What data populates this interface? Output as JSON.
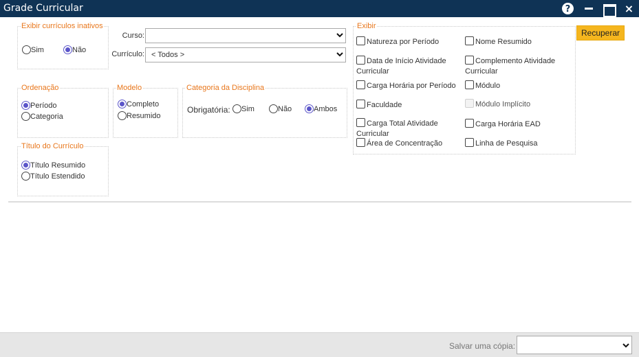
{
  "window": {
    "title": "Grade Curricular",
    "help_label": "?",
    "close_label": "×"
  },
  "inactive_group": {
    "legend": "Exibir currículos inativos",
    "options": [
      "Sim",
      "Não"
    ],
    "selected": "Não"
  },
  "filters": {
    "curso_label": "Curso:",
    "curso_value": "",
    "curriculo_label": "Currículo:",
    "curriculo_value": "< Todos >"
  },
  "ordenacao": {
    "legend": "Ordenação",
    "options": [
      "Período",
      "Categoria"
    ],
    "selected": "Período"
  },
  "modelo": {
    "legend": "Modelo",
    "options": [
      "Completo",
      "Resumido"
    ],
    "selected": "Completo"
  },
  "categoria": {
    "legend": "Categoria da Disciplina",
    "obrigatoria_label": "Obrigatória:",
    "options": [
      "Sim",
      "Não",
      "Ambos"
    ],
    "selected": "Ambos"
  },
  "titulo": {
    "legend": "Título do Currículo",
    "options": [
      "Título Resumido",
      "Título Estendido"
    ],
    "selected": "Título Resumido"
  },
  "exibir": {
    "legend": "Exibir",
    "items": [
      {
        "label": "Natureza por Período",
        "checked": false,
        "disabled": false
      },
      {
        "label": "Nome Resumido",
        "checked": false,
        "disabled": false
      },
      {
        "label": "Data de Início Atividade Curricular",
        "checked": false,
        "disabled": false
      },
      {
        "label": "Complemento Atividade Curricular",
        "checked": false,
        "disabled": false
      },
      {
        "label": "Carga Horária por Período",
        "checked": false,
        "disabled": false
      },
      {
        "label": "Módulo",
        "checked": false,
        "disabled": false
      },
      {
        "label": "Faculdade",
        "checked": false,
        "disabled": false
      },
      {
        "label": "Módulo Implícito",
        "checked": false,
        "disabled": true
      },
      {
        "label": "Carga Total Atividade Curricular",
        "checked": false,
        "disabled": false
      },
      {
        "label": "Carga Horária EAD",
        "checked": false,
        "disabled": false
      },
      {
        "label": "Área de Concentração",
        "checked": false,
        "disabled": false
      },
      {
        "label": "Linha de Pesquisa",
        "checked": false,
        "disabled": false
      }
    ]
  },
  "actions": {
    "recuperar_label": "Recuperar"
  },
  "footer": {
    "save_copy_label": "Salvar uma cópia:",
    "save_copy_value": ""
  },
  "colors": {
    "titlebar": "#0f3355",
    "legend": "#e8761b",
    "radio_selected": "#5b55c9",
    "button": "#f5b61e"
  }
}
